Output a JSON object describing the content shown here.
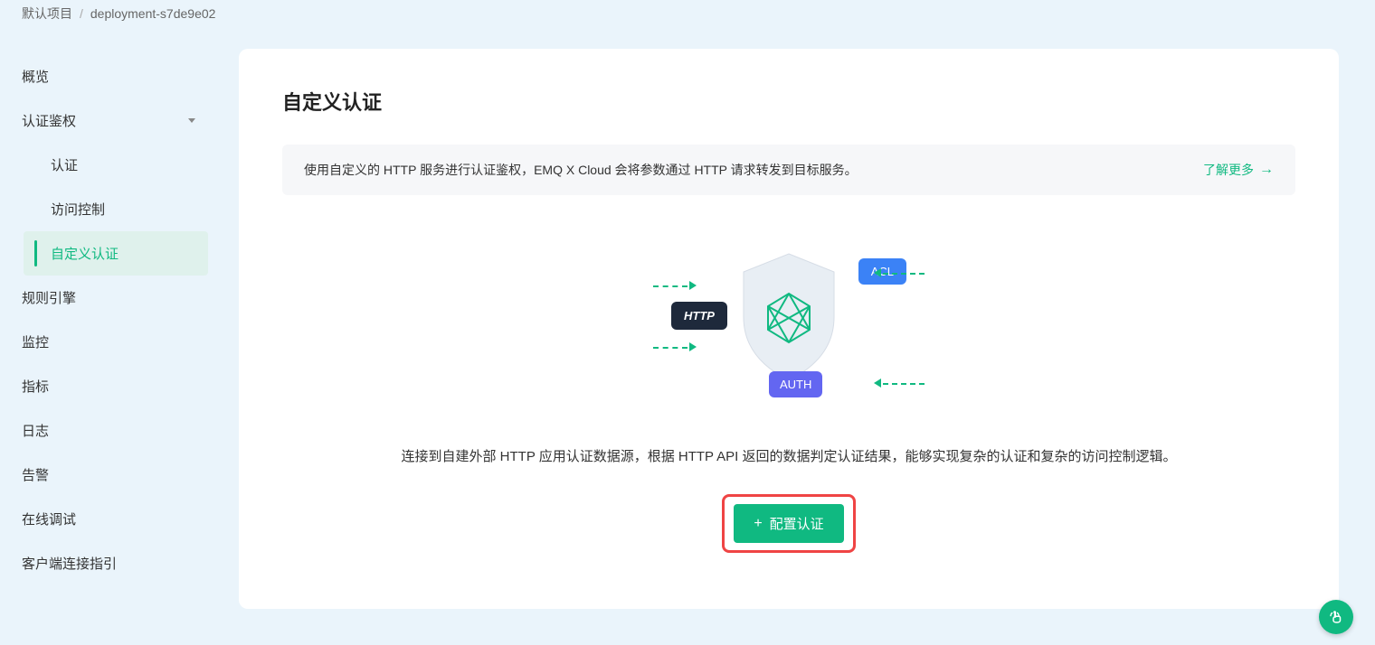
{
  "breadcrumb": {
    "project": "默认项目",
    "deployment": "deployment-s7de9e02"
  },
  "sidebar": {
    "overview": "概览",
    "auth": "认证鉴权",
    "auth_sub": {
      "authn": "认证",
      "acl": "访问控制",
      "custom": "自定义认证"
    },
    "rules": "规则引擎",
    "monitor": "监控",
    "metrics": "指标",
    "logs": "日志",
    "alarms": "告警",
    "online_debug": "在线调试",
    "client_guide": "客户端连接指引"
  },
  "page": {
    "title": "自定义认证",
    "banner_text": "使用自定义的 HTTP 服务进行认证鉴权，EMQ X Cloud 会将参数通过 HTTP 请求转发到目标服务。",
    "learn_more": "了解更多",
    "description": "连接到自建外部 HTTP 应用认证数据源，根据 HTTP API 返回的数据判定认证结果，能够实现复杂的认证和复杂的访问控制逻辑。",
    "config_button": "配置认证",
    "illustration": {
      "http": "HTTP",
      "acl": "ACL",
      "auth": "AUTH"
    }
  },
  "colors": {
    "accent": "#10b981",
    "highlight": "#ef4444"
  }
}
